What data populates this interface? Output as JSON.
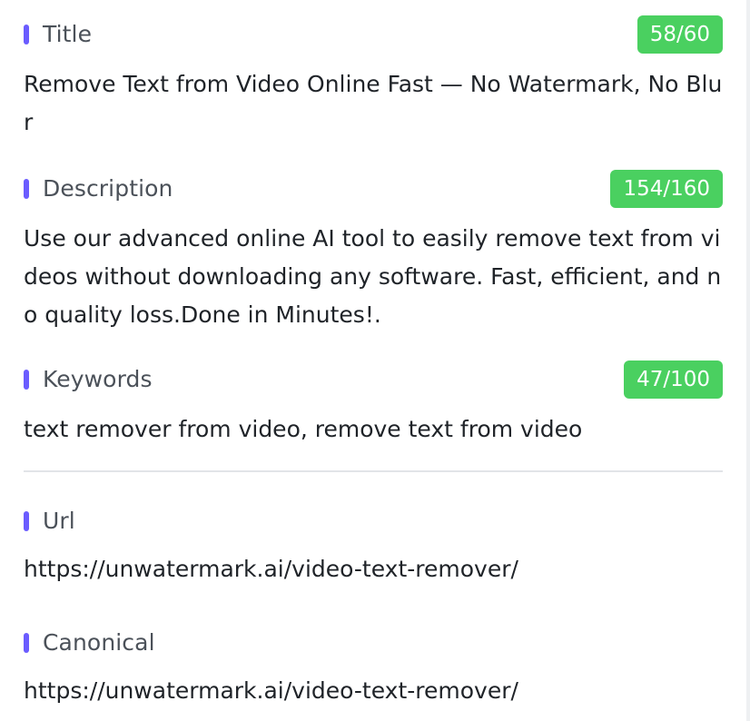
{
  "fields": {
    "title": {
      "label": "Title",
      "count": "58/60",
      "value": "Remove Text from Video Online Fast — No Watermark, No Blur"
    },
    "description": {
      "label": "Description",
      "count": "154/160",
      "value": "Use our advanced online AI tool to easily remove text from videos without downloading any software. Fast, efficient, and no quality loss.Done in Minutes!."
    },
    "keywords": {
      "label": "Keywords",
      "count": "47/100",
      "value": "text remover from video, remove text from video"
    },
    "url": {
      "label": "Url",
      "value": "https://unwatermark.ai/video-text-remover/"
    },
    "canonical": {
      "label": "Canonical",
      "value": "https://unwatermark.ai/video-text-remover/"
    }
  },
  "colors": {
    "accent_bar": "#6b5cff",
    "badge_ok": "#4ad060"
  }
}
